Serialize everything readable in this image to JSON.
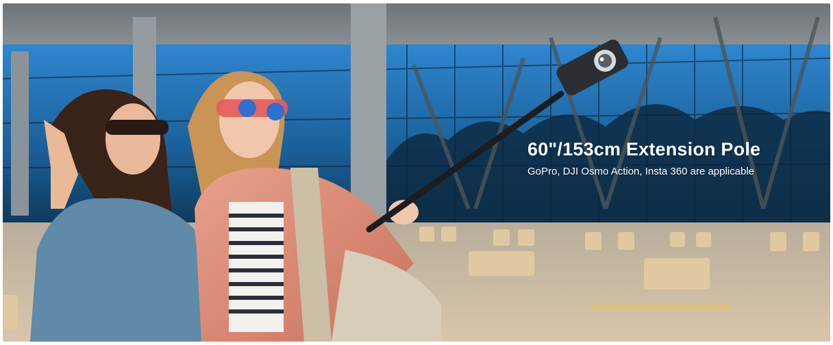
{
  "banner": {
    "headline": "60\"/153cm Extension Pole",
    "subline": "GoPro, DJI Osmo Action, Insta 360 are applicable"
  },
  "palette": {
    "sky_glass": "#1d6fb0",
    "building_grey": "#8b939a",
    "ground": "#c9bba6",
    "curb": "#e0c9a0",
    "jacket": "#d98a74",
    "shirt": "#5f8aa8",
    "camera": "#2b2e33",
    "headline_text": "#ffffff"
  },
  "icons": [
    "camera-icon"
  ]
}
